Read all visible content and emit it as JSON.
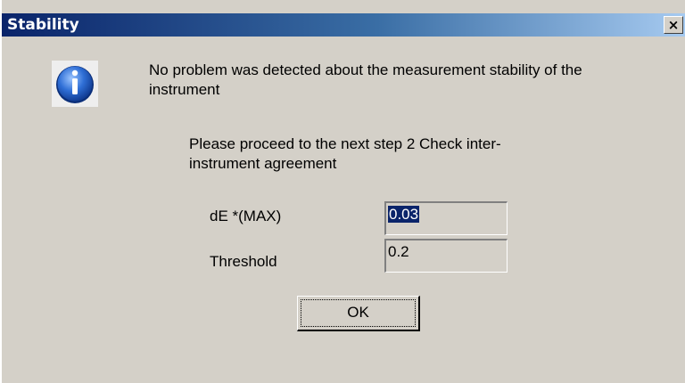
{
  "window": {
    "title": "Stability",
    "close_label": "×"
  },
  "message": {
    "line1": "No problem was detected about the measurement stability of the instrument",
    "line2": "Please proceed to the next step 2 Check inter-instrument agreement",
    "icon": "info-icon"
  },
  "fields": {
    "de_label": "dE *(MAX)",
    "de_value": "0.03",
    "threshold_label": "Threshold",
    "threshold_value": "0.2"
  },
  "buttons": {
    "ok_label": "OK"
  },
  "colors": {
    "titlebar_start": "#0a246a",
    "titlebar_end": "#a6caf0",
    "dialog_bg": "#d4d0c8",
    "selection": "#0a246a"
  }
}
